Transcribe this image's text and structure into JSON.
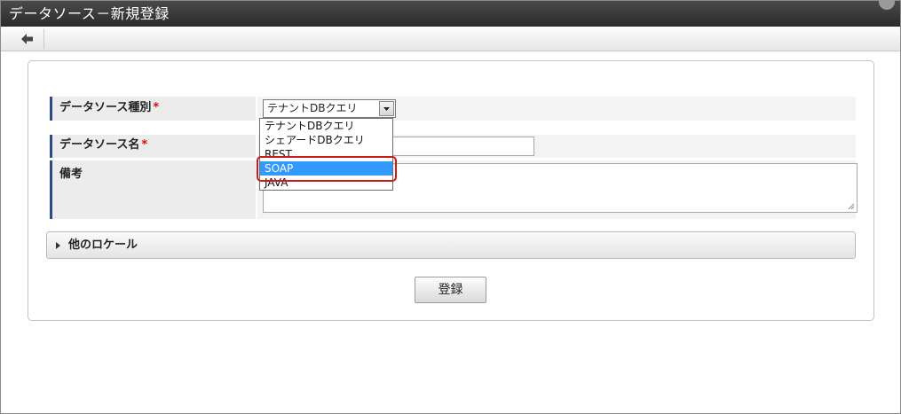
{
  "window": {
    "title": "データソース－新規登録"
  },
  "toolbar": {
    "back_icon": "arrow-left-icon"
  },
  "form": {
    "type_label": "データソース種別",
    "type_selected": "テナントDBクエリ",
    "name_label": "データソース名",
    "remarks_label": "備考",
    "required_mark": "*",
    "name_value": "",
    "remarks_value": ""
  },
  "dropdown": {
    "options": [
      "テナントDBクエリ",
      "シェアードDBクエリ",
      "REST",
      "SOAP",
      "JAVA"
    ],
    "highlighted": "SOAP"
  },
  "locale_section": {
    "label": "他のロケール"
  },
  "actions": {
    "register_label": "登録"
  },
  "colors": {
    "accent": "#2f4a86",
    "selection": "#3399ff",
    "highlight_border": "#d01818",
    "required": "#d01010"
  }
}
